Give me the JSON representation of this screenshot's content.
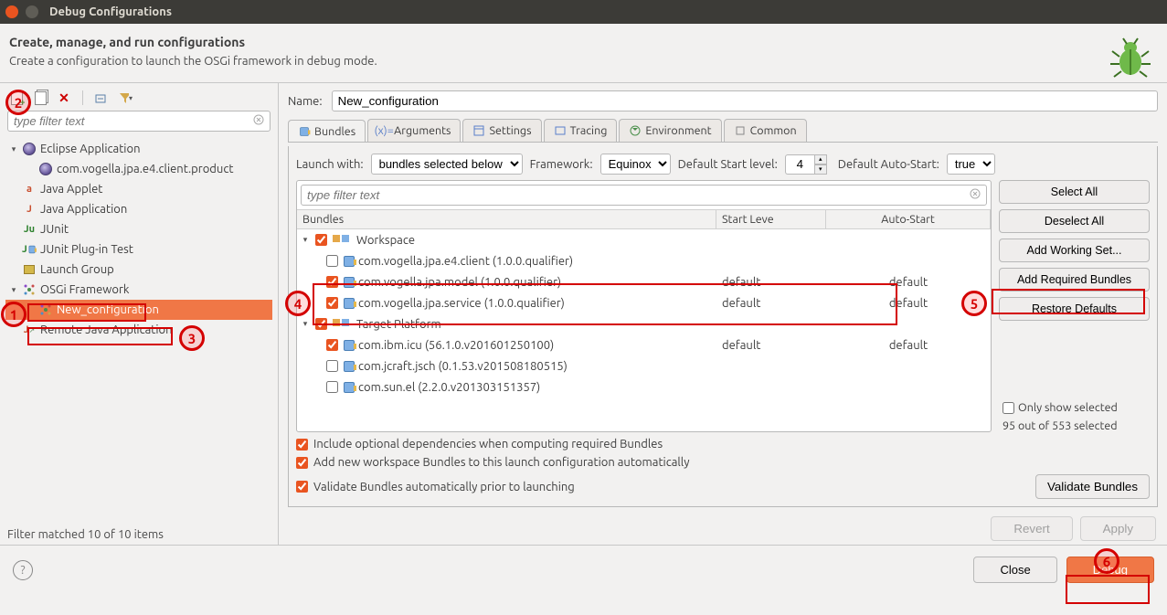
{
  "window": {
    "title": "Debug Configurations"
  },
  "header": {
    "title": "Create, manage, and run configurations",
    "subtitle": "Create a configuration to launch the OSGi framework in debug mode."
  },
  "left": {
    "filter_placeholder": "type filter text",
    "tree": [
      {
        "label": "Eclipse Application",
        "icon": "eclipse",
        "expanded": true
      },
      {
        "label": "com.vogella.jpa.e4.client.product",
        "icon": "eclipse",
        "indent": 1
      },
      {
        "label": "Java Applet",
        "icon": "java-a"
      },
      {
        "label": "Java Application",
        "icon": "java-j"
      },
      {
        "label": "JUnit",
        "icon": "junit"
      },
      {
        "label": "JUnit Plug-in Test",
        "icon": "junit-plugin"
      },
      {
        "label": "Launch Group",
        "icon": "launch-group"
      },
      {
        "label": "OSGi Framework",
        "icon": "osgi",
        "expanded": true
      },
      {
        "label": "New_configuration",
        "icon": "osgi",
        "indent": 1,
        "selected": true
      },
      {
        "label": "Remote Java Application",
        "icon": "remote-java"
      }
    ],
    "filter_status": "Filter matched 10 of 10 items"
  },
  "right": {
    "name_label": "Name:",
    "name_value": "New_configuration",
    "tabs": [
      {
        "label": "Bundles",
        "active": true
      },
      {
        "label": "Arguments"
      },
      {
        "label": "Settings"
      },
      {
        "label": "Tracing"
      },
      {
        "label": "Environment"
      },
      {
        "label": "Common"
      }
    ],
    "launch": {
      "launch_with_label": "Launch with:",
      "launch_with_value": "bundles selected below",
      "framework_label": "Framework:",
      "framework_value": "Equinox",
      "default_start_label": "Default Start level:",
      "default_start_value": "4",
      "default_auto_label": "Default Auto-Start:",
      "default_auto_value": "true"
    },
    "bundle_filter_placeholder": "type filter text",
    "bundle_columns": {
      "name": "Bundles",
      "start": "Start Leve",
      "auto": "Auto-Start"
    },
    "bundle_rows": [
      {
        "type": "group",
        "label": "Workspace",
        "checked": true,
        "expanded": true
      },
      {
        "type": "bundle",
        "label": "com.vogella.jpa.e4.client (1.0.0.qualifier)",
        "checked": false,
        "start": "",
        "auto": ""
      },
      {
        "type": "bundle",
        "label": "com.vogella.jpa.model (1.0.0.qualifier)",
        "checked": true,
        "start": "default",
        "auto": "default"
      },
      {
        "type": "bundle",
        "label": "com.vogella.jpa.service (1.0.0.qualifier)",
        "checked": true,
        "start": "default",
        "auto": "default"
      },
      {
        "type": "group",
        "label": "Target Platform",
        "checked": true,
        "expanded": true
      },
      {
        "type": "bundle",
        "label": "com.ibm.icu (56.1.0.v201601250100)",
        "checked": true,
        "start": "default",
        "auto": "default"
      },
      {
        "type": "bundle",
        "label": "com.jcraft.jsch (0.1.53.v201508180515)",
        "checked": false,
        "start": "",
        "auto": ""
      },
      {
        "type": "bundle",
        "label": "com.sun.el (2.2.0.v201303151357)",
        "checked": false,
        "start": "",
        "auto": ""
      }
    ],
    "side_buttons": {
      "select_all": "Select All",
      "deselect_all": "Deselect All",
      "add_working_set": "Add Working Set...",
      "add_required": "Add Required Bundles",
      "restore_defaults": "Restore Defaults",
      "only_selected": "Only show selected",
      "count": "95 out of 553 selected"
    },
    "checks": {
      "include_optional": "Include optional dependencies when computing required Bundles",
      "add_new_workspace": "Add new workspace Bundles to this launch configuration automatically",
      "validate_auto": "Validate Bundles automatically prior to launching",
      "validate_button": "Validate Bundles"
    },
    "revert": "Revert",
    "apply": "Apply"
  },
  "footer": {
    "close": "Close",
    "debug": "Debug"
  },
  "annotations": [
    "1",
    "2",
    "3",
    "4",
    "5",
    "6"
  ]
}
